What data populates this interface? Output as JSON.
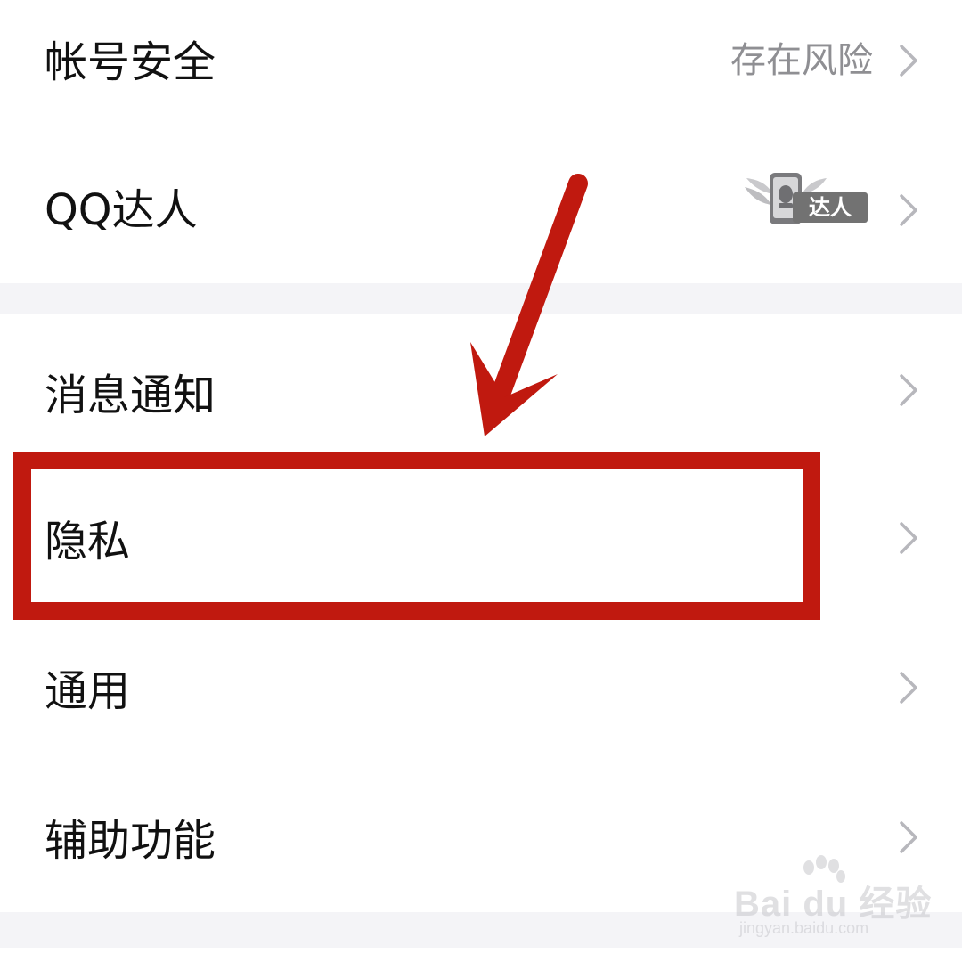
{
  "settings": {
    "group1": [
      {
        "label": "帐号安全",
        "value": "存在风险"
      },
      {
        "label": "QQ达人",
        "badge_text": "达人",
        "badge_icon": "qq-talent-wings-icon"
      }
    ],
    "group2": [
      {
        "label": "消息通知"
      },
      {
        "label": "隐私"
      },
      {
        "label": "通用"
      },
      {
        "label": "辅助功能"
      }
    ]
  },
  "annotation": {
    "color": "#c0190f",
    "target": "隐私"
  },
  "watermark": {
    "logo": "Bai du 经验",
    "url": "jingyan.baidu.com"
  }
}
